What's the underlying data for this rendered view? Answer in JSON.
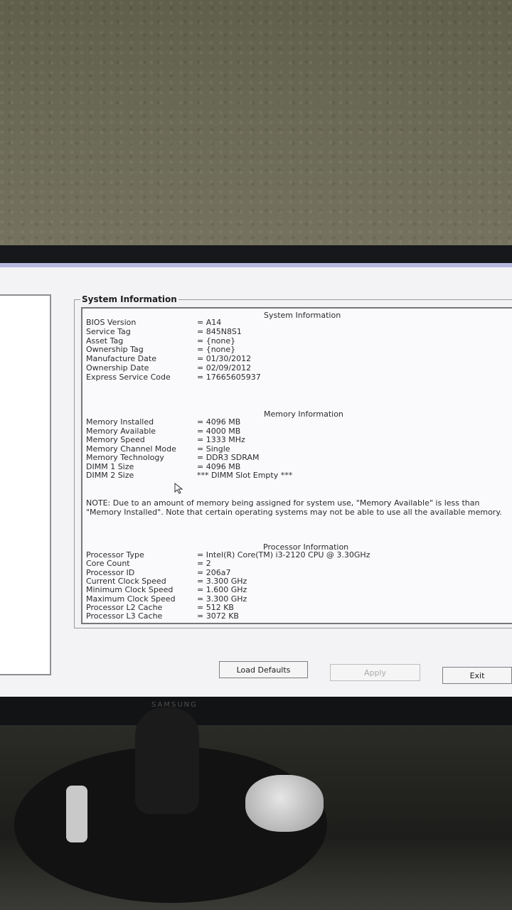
{
  "group_title": "System Information",
  "sections": {
    "system": {
      "title": "System Information",
      "rows": [
        {
          "label": "BIOS Version",
          "value": "= A14"
        },
        {
          "label": "Service Tag",
          "value": "= 845N8S1"
        },
        {
          "label": "Asset Tag",
          "value": "= {none}"
        },
        {
          "label": "Ownership Tag",
          "value": "= {none}"
        },
        {
          "label": "Manufacture Date",
          "value": "= 01/30/2012"
        },
        {
          "label": "Ownership Date",
          "value": "= 02/09/2012"
        },
        {
          "label": "Express Service Code",
          "value": "= 17665605937"
        }
      ]
    },
    "memory": {
      "title": "Memory Information",
      "rows": [
        {
          "label": "Memory Installed",
          "value": "= 4096 MB"
        },
        {
          "label": "Memory Available",
          "value": "= 4000 MB"
        },
        {
          "label": "Memory Speed",
          "value": "= 1333 MHz"
        },
        {
          "label": "Memory Channel Mode",
          "value": "= Single"
        },
        {
          "label": "Memory Technology",
          "value": "= DDR3 SDRAM"
        },
        {
          "label": "DIMM 1 Size",
          "value": "= 4096 MB"
        },
        {
          "label": "DIMM 2 Size",
          "value": "*** DIMM Slot Empty ***"
        }
      ],
      "note": "NOTE: Due to an amount of memory being assigned for system use, \"Memory Available\" is less than \"Memory Installed\". Note that certain operating systems may not be able to use all the available memory."
    },
    "processor": {
      "title": "Processor Information",
      "rows": [
        {
          "label": "Processor Type",
          "value": "= Intel(R) Core(TM) i3-2120 CPU @ 3.30GHz"
        },
        {
          "label": "Core Count",
          "value": "= 2"
        },
        {
          "label": "Processor ID",
          "value": "= 206a7"
        },
        {
          "label": "Current Clock Speed",
          "value": "= 3.300 GHz"
        },
        {
          "label": "Minimum Clock Speed",
          "value": "= 1.600 GHz"
        },
        {
          "label": "Maximum Clock Speed",
          "value": "= 3.300 GHz"
        },
        {
          "label": "Processor L2 Cache",
          "value": "= 512 KB"
        },
        {
          "label": "Processor L3 Cache",
          "value": "= 3072 KB"
        }
      ]
    }
  },
  "buttons": {
    "load_defaults": "Load Defaults",
    "apply": "Apply",
    "exit": "Exit"
  },
  "monitor_brand": "SAMSUNG"
}
